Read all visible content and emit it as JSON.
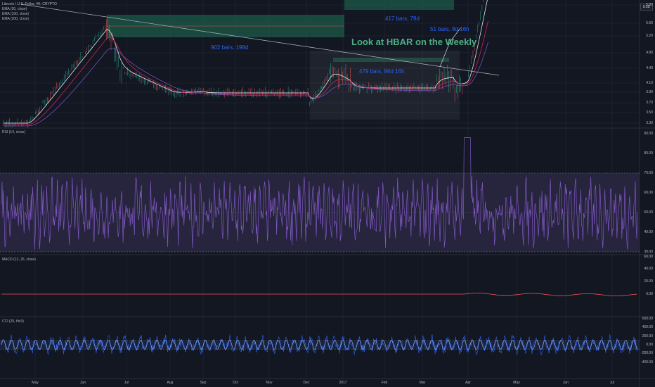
{
  "legend": {
    "title": "Litecoin / U.S. Dollar, 4H, CRYPTO",
    "ema50": "EMA (50, close)",
    "ema100": "EMA (100, close)",
    "ema200": "EMA (200, close)",
    "rsi": "RSI (14, close)",
    "macd": "MACD (12, 26, close)",
    "cci": "CCI (20, hlc3)"
  },
  "annotations": {
    "bars_417": "417 bars, 79d",
    "bars_902": "902 bars, 198d",
    "bars_51": "51 bars, 8d 16h",
    "bars_479": "479 bars, 96d 16h",
    "hbar_note": "Look at HBAR on the Weekly"
  },
  "currency": "USD",
  "colors": {
    "background": "#131722",
    "grid": "#1e222d",
    "candle_up": "#26a69a",
    "candle_down": "#ef5350",
    "rsi_line": "#7e57c2",
    "rsi_band": "#2a2640",
    "macd_line": "#ef5350",
    "cci_line": "#2962ff",
    "zone_green": "#1b5e4a",
    "annotation_blue": "#2962ff",
    "annotation_green": "#4caf86"
  },
  "chart_data": [
    {
      "type": "line",
      "title": "Litecoin / U.S. Dollar, 4H, CRYPTO",
      "yticks": [
        "5.80",
        "5.60",
        "5.20",
        "4.80",
        "4.40",
        "4.10",
        "3.90",
        "3.70",
        "3.50",
        "3.30"
      ],
      "xticks": [
        "May",
        "Jun",
        "Jul",
        "Aug",
        "Sep",
        "Oct",
        "Nov",
        "Dec",
        "2017",
        "Feb",
        "Mar",
        "Apr",
        "May",
        "Jun",
        "Jul"
      ],
      "series": [
        {
          "name": "Litecoin / U.S. Dollar",
          "x": [
            "May",
            "Jun",
            "Jul",
            "Aug",
            "Sep",
            "Oct",
            "Nov",
            "Dec",
            "2017",
            "Feb",
            "Mar",
            "Apr",
            "May",
            "Jun",
            "Jul"
          ],
          "values": [
            3.3,
            4.4,
            4.0,
            3.8,
            3.85,
            3.88,
            3.9,
            3.82,
            4.0,
            3.9,
            3.95,
            5.8,
            6.5,
            6.8,
            7.0
          ]
        },
        {
          "name": "EMA (50, close)",
          "values": [
            3.32,
            4.2,
            4.05,
            3.85,
            3.86,
            3.88,
            3.89,
            3.85,
            3.95,
            3.92,
            3.95,
            4.6,
            5.8,
            6.4,
            6.8
          ]
        },
        {
          "name": "EMA (100, close)",
          "values": [
            3.34,
            4.0,
            4.05,
            3.9,
            3.87,
            3.88,
            3.88,
            3.86,
            3.92,
            3.92,
            3.94,
            4.3,
            5.4,
            6.1,
            6.6
          ]
        },
        {
          "name": "EMA (200, close)",
          "values": [
            3.36,
            3.8,
            4.0,
            3.92,
            3.88,
            3.88,
            3.88,
            3.87,
            3.9,
            3.91,
            3.93,
            4.1,
            5.0,
            5.8,
            6.3
          ]
        }
      ]
    },
    {
      "type": "line",
      "title": "RSI (14, close)",
      "yticks": [
        "90.00",
        "80.00",
        "70.00",
        "60.00",
        "50.00",
        "40.00",
        "30.00"
      ],
      "band": [
        30,
        70
      ],
      "series": [
        {
          "name": "RSI (14, close)",
          "values": [
            55,
            72,
            48,
            40,
            52,
            50,
            55,
            45,
            60,
            50,
            52,
            90,
            65,
            55,
            58
          ]
        }
      ]
    },
    {
      "type": "line",
      "title": "MACD (12, 26, close)",
      "yticks": [
        "60.00",
        "40.00",
        "20.00",
        "0.00"
      ],
      "series": [
        {
          "name": "MACD (12, 26, close)",
          "values": [
            0,
            0,
            0,
            0,
            0,
            0,
            0,
            0,
            0,
            0,
            0,
            1,
            3,
            5,
            2
          ]
        }
      ]
    },
    {
      "type": "line",
      "title": "CCI (20, hlc3)",
      "yticks": [
        "600.00",
        "400.00",
        "200.00",
        "0.00",
        "-200.00",
        "-400.00"
      ],
      "series": [
        {
          "name": "CCI (20, hlc3)",
          "values": [
            50,
            -100,
            120,
            -80,
            60,
            -40,
            90,
            -150,
            200,
            -60,
            80,
            300,
            -100,
            150,
            -50
          ]
        }
      ]
    }
  ]
}
